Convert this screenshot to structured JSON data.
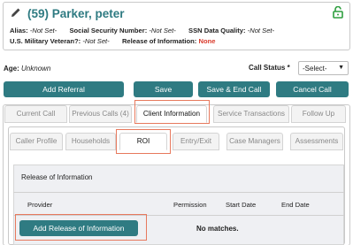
{
  "client": {
    "title": "(59) Parker, peter"
  },
  "meta": {
    "alias_label": "Alias:",
    "alias_value": "-Not Set-",
    "ssn_label": "Social Security Number:",
    "ssn_value": "-Not Set-",
    "ssn_quality_label": "SSN Data Quality:",
    "ssn_quality_value": "-Not Set-",
    "veteran_label": "U.S. Military Veteran?:",
    "veteran_value": "-Not Set-",
    "release_label": "Release of Information:",
    "release_value": "None"
  },
  "age": {
    "label": "Age:",
    "value": "Unknown"
  },
  "call_status": {
    "label": "Call Status *",
    "selected": "-Select-"
  },
  "buttons": {
    "add_referral": "Add Referral",
    "save": "Save",
    "save_end_call": "Save & End Call",
    "cancel_call": "Cancel Call"
  },
  "main_tabs": [
    {
      "label": "Current Call"
    },
    {
      "label": "Previous Calls (4)"
    },
    {
      "label": "Client Information"
    },
    {
      "label": "Service Transactions"
    },
    {
      "label": "Follow Up"
    }
  ],
  "sub_tabs": [
    {
      "label": "Caller Profile"
    },
    {
      "label": "Households"
    },
    {
      "label": "ROI"
    },
    {
      "label": "Entry/Exit"
    },
    {
      "label": "Case Managers"
    },
    {
      "label": "Assessments"
    }
  ],
  "roi_section": {
    "title": "Release of Information",
    "columns": [
      "Provider",
      "Permission",
      "Start Date",
      "End Date"
    ],
    "add_button": "Add Release of Information",
    "empty_text": "No matches."
  },
  "colors": {
    "teal": "#2f7b82",
    "lock_green": "#2e9e3f",
    "highlight": "#e7795d",
    "red": "#d93a2b"
  },
  "icons": {
    "edit": "pencil-icon",
    "lock": "unlock-icon",
    "dropdown": "caret-down-icon"
  }
}
